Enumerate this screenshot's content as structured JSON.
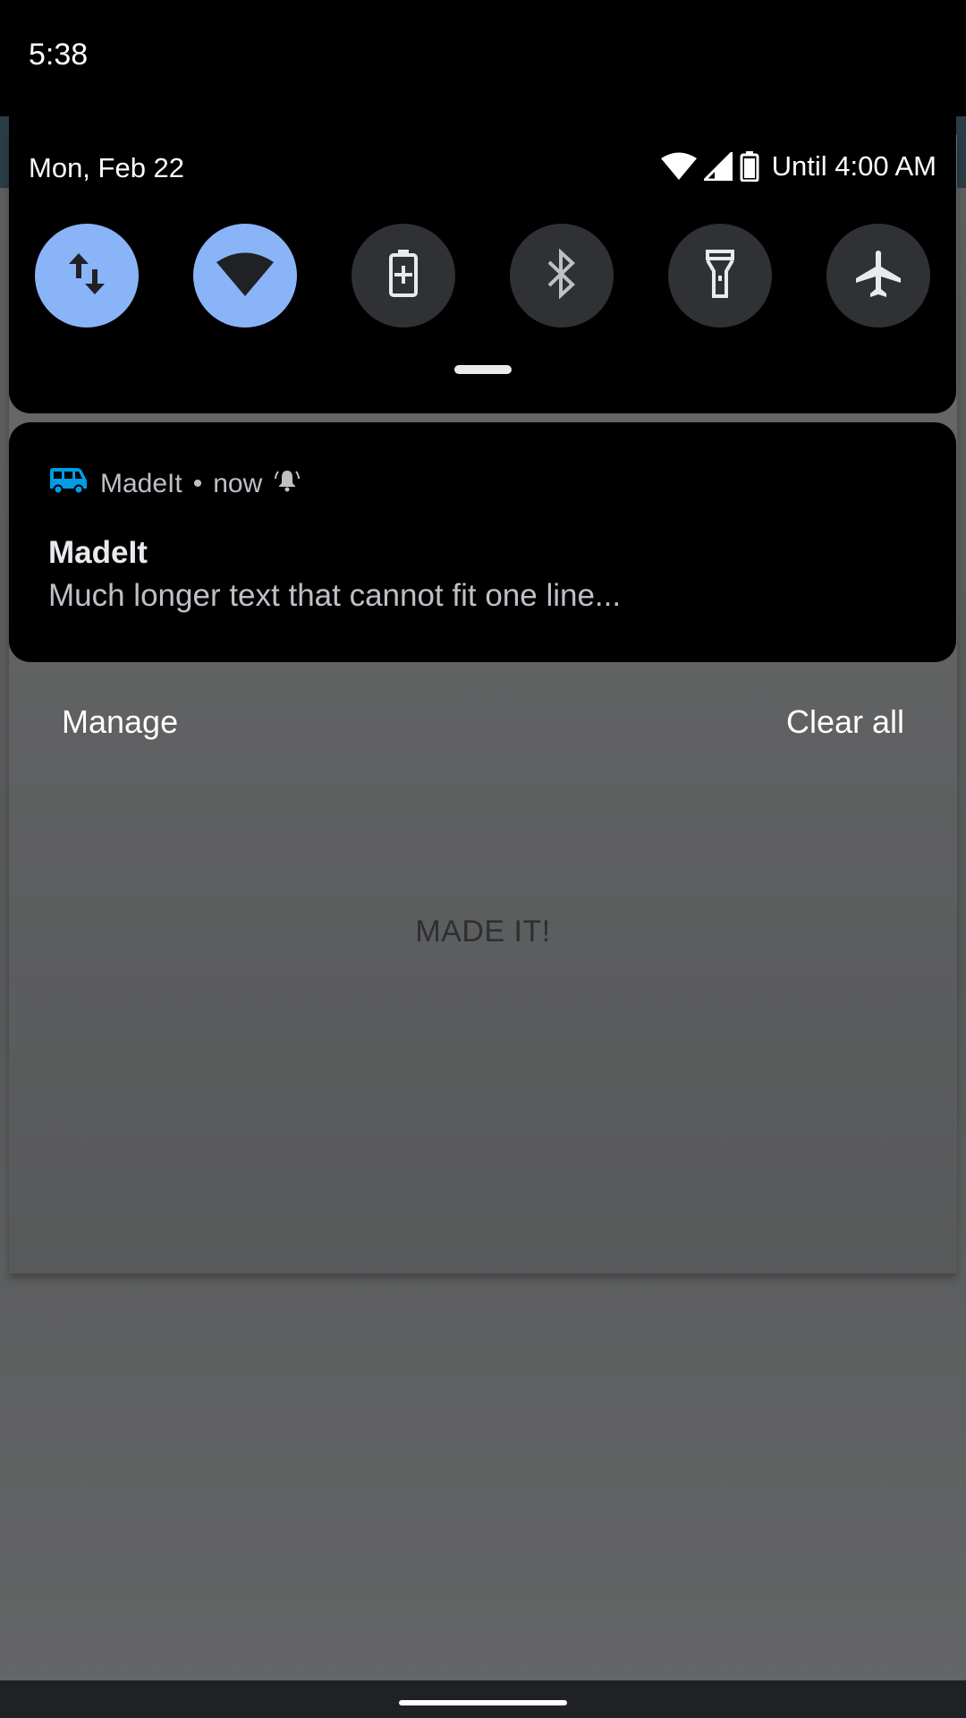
{
  "status_bar": {
    "time": "5:38"
  },
  "quick_settings": {
    "date": "Mon, Feb 22",
    "battery_text": "Until 4:00 AM",
    "tiles": [
      {
        "name": "mobile-data",
        "icon": "swap-vert-icon",
        "state": "on"
      },
      {
        "name": "wifi",
        "icon": "wifi-icon",
        "state": "on"
      },
      {
        "name": "battery-saver",
        "icon": "battery-saver-icon",
        "state": "off"
      },
      {
        "name": "bluetooth",
        "icon": "bluetooth-icon",
        "state": "off"
      },
      {
        "name": "flashlight",
        "icon": "flashlight-icon",
        "state": "off"
      },
      {
        "name": "airplane-mode",
        "icon": "airplane-icon",
        "state": "off"
      }
    ],
    "colors": {
      "tile_on": "#8ab4f8",
      "tile_off": "#303134"
    }
  },
  "notification": {
    "app_name": "MadeIt",
    "separator": "•",
    "time": "now",
    "app_icon": "bus-icon",
    "alert_icon": "bell-icon",
    "title": "MadeIt",
    "text": "Much longer text that cannot fit one line...",
    "accent_color": "#039be5"
  },
  "footer": {
    "manage_label": "Manage",
    "clear_all_label": "Clear all"
  },
  "app": {
    "center_text": "MADE IT!"
  }
}
